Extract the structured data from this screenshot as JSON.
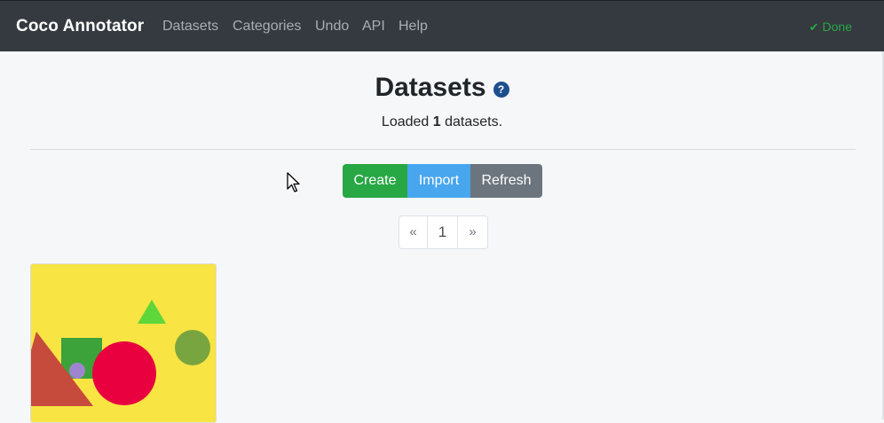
{
  "app": {
    "title": "Coco Annotator"
  },
  "nav": {
    "items": [
      {
        "label": "Datasets"
      },
      {
        "label": "Categories"
      },
      {
        "label": "Undo"
      },
      {
        "label": "API"
      },
      {
        "label": "Help"
      }
    ],
    "status": {
      "label": "Done",
      "icon": "check-icon",
      "color": "#28a745"
    }
  },
  "header": {
    "title": "Datasets",
    "help_icon": "question-circle-icon",
    "subtitle_prefix": "Loaded",
    "count": "1",
    "subtitle_suffix": "datasets."
  },
  "actions": {
    "create_label": "Create",
    "import_label": "Import",
    "refresh_label": "Refresh"
  },
  "pagination": {
    "prev": "«",
    "page": "1",
    "next": "»"
  },
  "colors": {
    "navbar": "#343a40",
    "create": "#28a745",
    "import": "#48a6ef",
    "refresh": "#6c757d",
    "thumbnail_bg": "#f8e443"
  },
  "datasets": [
    {
      "thumbnail": "shapes-image"
    }
  ]
}
